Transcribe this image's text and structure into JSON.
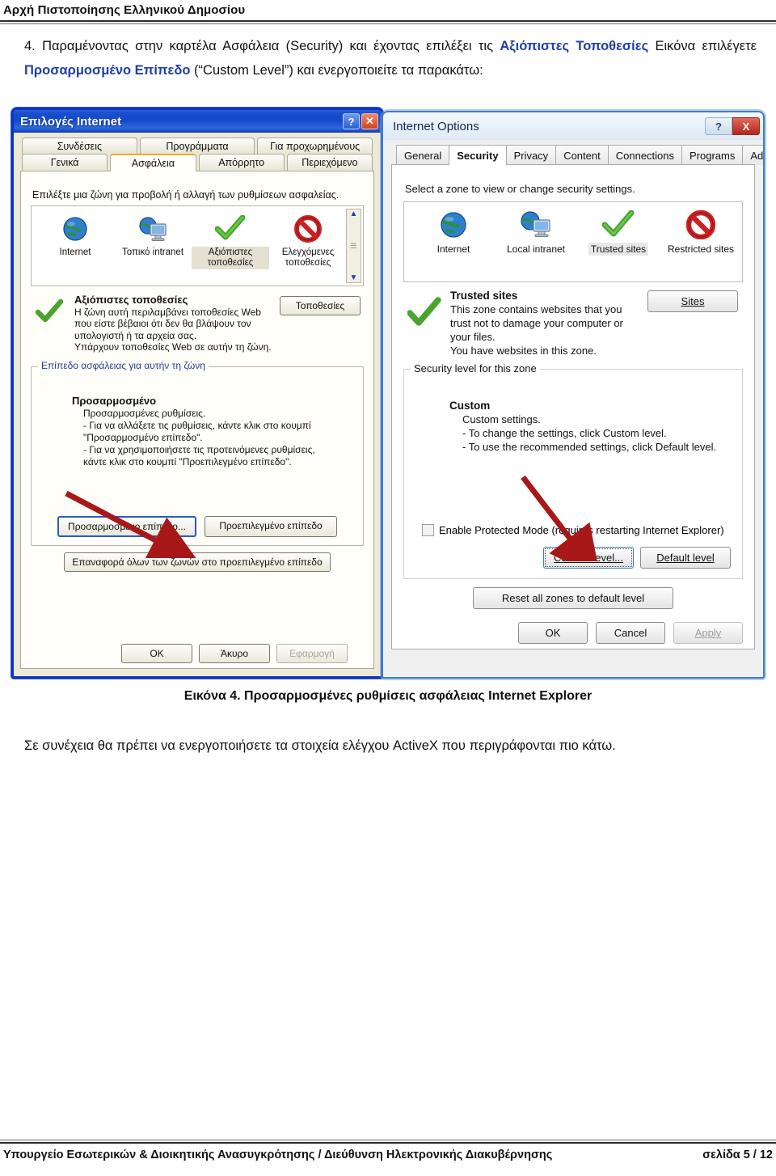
{
  "header": {
    "title": "Αρχή Πιστοποίησης Ελληνικού Δημοσίου"
  },
  "intro": {
    "part1": "4. Παραμένοντας στην καρτέλα Ασφάλεια (Security) και έχοντας επιλέξει τις ",
    "accent1": "Αξιόπιστες Τοποθεσίες",
    "part2": " Εικόνα επιλέγετε ",
    "accent2": "Προσαρμοσμένο Επίπεδο",
    "part3": " (“Custom Level”) και ενεργοποιείτε τα παρακάτω:"
  },
  "xp_dialog": {
    "title": "Επιλογές Internet",
    "help_button": "?",
    "close_button": "✕",
    "tabs_row1": [
      "Συνδέσεις",
      "Προγράμματα",
      "Για προχωρημένους"
    ],
    "tabs_row2": [
      "Γενικά",
      "Ασφάλεια",
      "Απόρρητο",
      "Περιεχόμενο"
    ],
    "active_tab": "Ασφάλεια",
    "lead": "Επιλέξτε μια ζώνη για προβολή ή αλλαγή των ρυθμίσεων ασφαλείας.",
    "zones": [
      {
        "label": "Internet",
        "icon": "globe-icon",
        "selected": false
      },
      {
        "label": "Τοπικό intranet",
        "icon": "globe-computer-icon",
        "selected": false
      },
      {
        "label": "Αξιόπιστες τοποθεσίες",
        "icon": "green-check-icon",
        "selected": true
      },
      {
        "label": "Ελεγχόμενες τοποθεσίες",
        "icon": "restricted-icon",
        "selected": false
      }
    ],
    "zone_title": "Αξιόπιστες τοποθεσίες",
    "zone_desc_lines": [
      "Η ζώνη αυτή περιλαμβάνει τοποθεσίες Web",
      "που είστε βέβαιοι ότι δεν θα βλάψουν τον",
      "υπολογιστή ή τα αρχεία σας.",
      "Υπάρχουν τοποθεσίες Web σε αυτήν τη ζώνη."
    ],
    "sites_button": "Τοποθεσίες",
    "group_legend": "Επίπεδο ασφάλειας για αυτήν τη ζώνη",
    "level_title": "Προσαρμοσμένο",
    "level_lines": [
      "Προσαρμοσμένες ρυθμίσεις.",
      "- Για να αλλάξετε τις ρυθμίσεις, κάντε κλικ στο κουμπί",
      "\"Προσαρμοσμένο επίπεδο\".",
      "- Για να χρησιμοποιήσετε τις προτεινόμενες ρυθμίσεις,",
      "κάντε κλικ στο κουμπί \"Προεπιλεγμένο επίπεδο\"."
    ],
    "custom_level_button": "Προσαρμοσμένο επίπεδο...",
    "default_level_button": "Προεπιλεγμένο επίπεδο",
    "reset_button": "Επαναφορά όλων των ζωνών στο προεπιλεγμένο επίπεδο",
    "ok_button": "OK",
    "cancel_button": "Άκυρο",
    "apply_button": "Εφαρμογή"
  },
  "aero_dialog": {
    "title": "Internet Options",
    "help_button": "?",
    "close_button": "X",
    "tabs": [
      "General",
      "Security",
      "Privacy",
      "Content",
      "Connections",
      "Programs",
      "Advanced"
    ],
    "active_tab": "Security",
    "lead": "Select a zone to view or change security settings.",
    "zones": [
      {
        "label": "Internet",
        "icon": "globe-icon",
        "selected": false
      },
      {
        "label": "Local intranet",
        "icon": "globe-computer-icon",
        "selected": false
      },
      {
        "label": "Trusted sites",
        "icon": "green-check-icon",
        "selected": true
      },
      {
        "label": "Restricted sites",
        "icon": "restricted-icon",
        "selected": false
      }
    ],
    "zone_title": "Trusted sites",
    "zone_desc_lines": [
      "This zone contains websites that you",
      "trust not to damage your computer or",
      "your files.",
      "You have websites in this zone."
    ],
    "sites_button": "Sites",
    "group_legend": "Security level for this zone",
    "level_title": "Custom",
    "level_lines": [
      "Custom settings.",
      "- To change the settings, click Custom level.",
      "- To use the recommended settings, click Default level."
    ],
    "protected_mode_label": "Enable Protected Mode (requires restarting Internet Explorer)",
    "protected_mode_checked": false,
    "custom_level_button": "Custom level...",
    "default_level_button": "Default level",
    "reset_button": "Reset all zones to default level",
    "ok_button": "OK",
    "cancel_button": "Cancel",
    "apply_button": "Apply"
  },
  "caption": "Εικόνα 4. Προσαρμοσμένες ρυθμίσεις ασφάλειας Internet Explorer",
  "after_text": "Σε συνέχεια θα πρέπει να ενεργοποιήσετε τα στοιχεία ελέγχου ActiveX που περιγράφονται πιο κάτω.",
  "footer": {
    "left": "Υπουργείο Εσωτερικών & Διοικητικής Ανασυγκρότησης / Διεύθυνση Ηλεκτρονικής Διακυβέρνησης",
    "right": "σελίδα 5 / 12"
  },
  "colors": {
    "accent_blue": "#1f3fa8",
    "xp_title_blue": "#1348c9",
    "aero_border_blue": "#3c7fcd",
    "check_green": "#4aa52e",
    "restricted_red": "#cc2222",
    "arrow_red": "#a81818"
  }
}
